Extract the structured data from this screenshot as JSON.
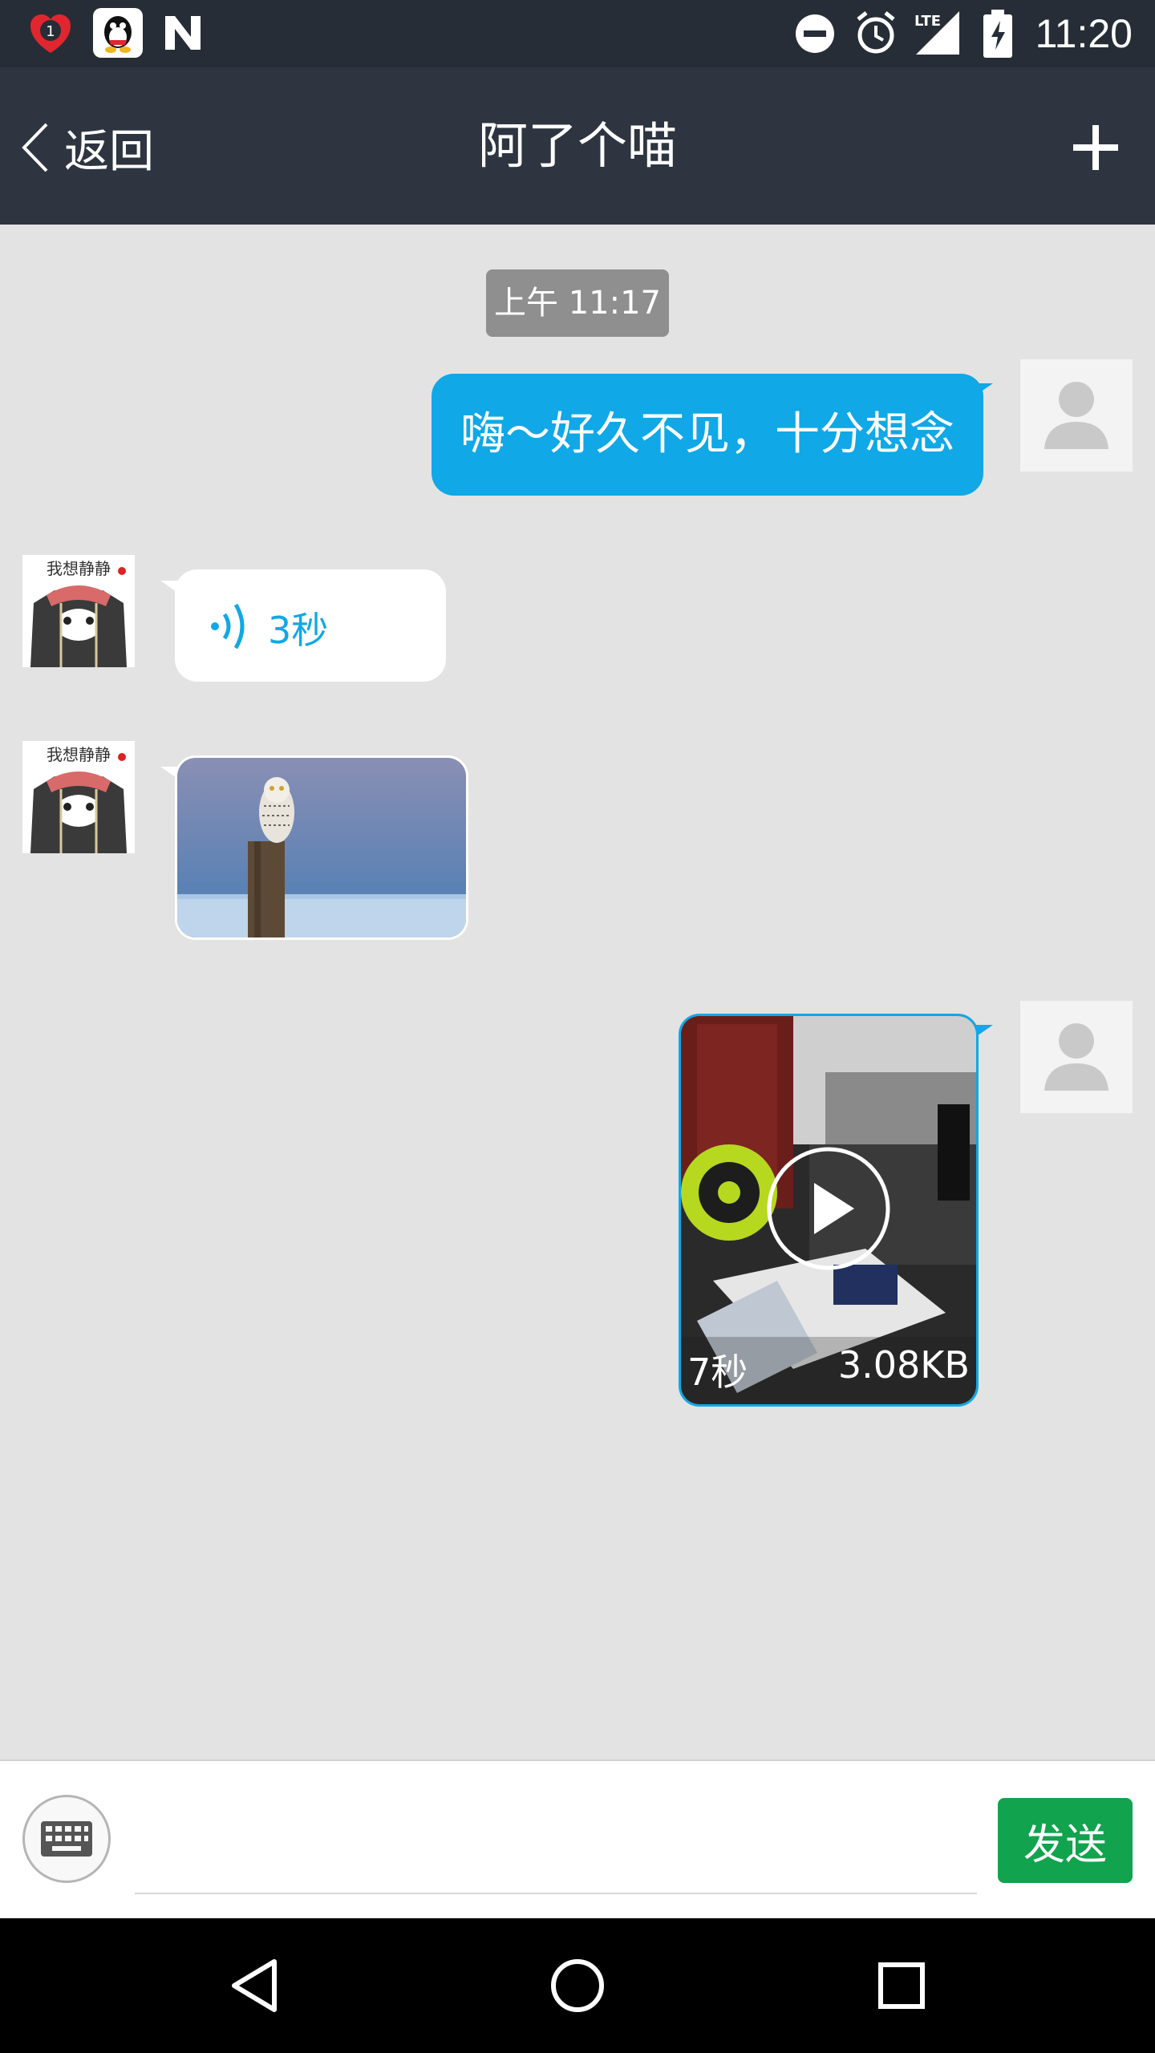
{
  "status_bar": {
    "time": "11:20",
    "notification_badge": "1",
    "network": "LTE",
    "icons": [
      "alarm-badge-icon",
      "qq-icon",
      "n-icon",
      "dnd-icon",
      "alarm-clock-icon",
      "signal-icon",
      "battery-charging-icon"
    ]
  },
  "header": {
    "back_label": "返回",
    "title": "阿了个喵",
    "add_icon": "plus-icon"
  },
  "messages": [
    {
      "type": "timestamp",
      "text": "上午 11:17"
    },
    {
      "type": "text",
      "direction": "outgoing",
      "text": "嗨～好久不见，十分想念"
    },
    {
      "type": "voice",
      "direction": "incoming",
      "duration": "3秒"
    },
    {
      "type": "image",
      "direction": "incoming",
      "subject": "owl-photo"
    },
    {
      "type": "video",
      "direction": "outgoing",
      "duration": "7秒",
      "size": "3.08KB"
    }
  ],
  "input": {
    "placeholder": "",
    "send_label": "发送"
  },
  "colors": {
    "accent_blue": "#10a8e6",
    "send_green": "#11a34d",
    "header_bg": "#2e3540"
  }
}
